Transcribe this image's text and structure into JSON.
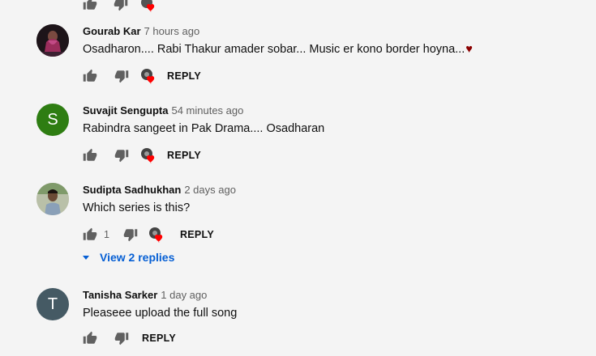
{
  "comments": [
    {
      "author": "Gourab Kar",
      "time": "7 hours ago",
      "text": "Osadharon.... Rabi Thakur amader sobar... Music er kono border hoyna...",
      "trailing_emoji": "♥",
      "reply_label": "REPLY"
    },
    {
      "author": "Suvajit Sengupta",
      "time": "54 minutes ago",
      "text": "Rabindra sangeet in Pak Drama.... Osadharan",
      "avatar_letter": "S",
      "avatar_color": "#2e7d12",
      "reply_label": "REPLY"
    },
    {
      "author": "Sudipta Sadhukhan",
      "time": "2 days ago",
      "text": "Which series is this?",
      "like_count": "1",
      "reply_label": "REPLY",
      "view_replies": "View 2 replies"
    },
    {
      "author": "Tanisha Sarker",
      "time": "1 day ago",
      "text": "Pleaseee upload the full song",
      "avatar_letter": "T",
      "avatar_color": "#455a64",
      "reply_label": "REPLY"
    }
  ],
  "colors": {
    "heart": "#ff0000",
    "link": "#065fd4",
    "meta": "#606060"
  },
  "icons": [
    "thumb-up-icon",
    "thumb-down-icon",
    "creator-heart-icon",
    "caret-down-icon"
  ]
}
